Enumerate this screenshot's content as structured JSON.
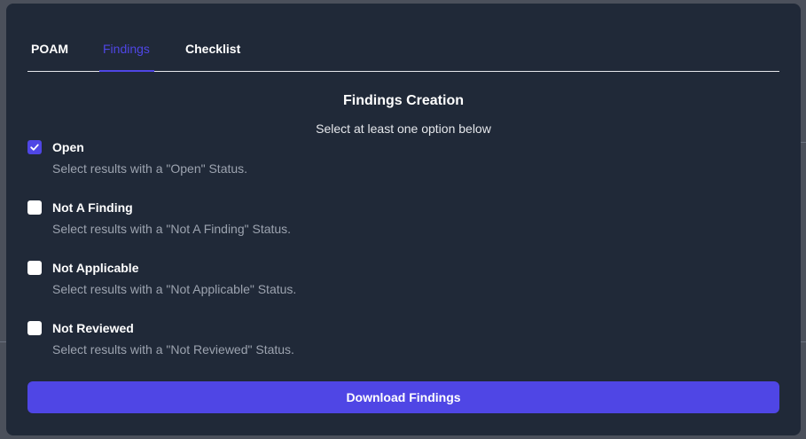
{
  "tabs": [
    {
      "label": "POAM"
    },
    {
      "label": "Findings"
    },
    {
      "label": "Checklist"
    }
  ],
  "active_tab": "Findings",
  "heading": "Findings Creation",
  "subheading": "Select at least one option below",
  "options": [
    {
      "label": "Open",
      "description": "Select results with a \"Open\" Status.",
      "checked": true
    },
    {
      "label": "Not A Finding",
      "description": "Select results with a \"Not A Finding\" Status.",
      "checked": false
    },
    {
      "label": "Not Applicable",
      "description": "Select results with a \"Not Applicable\" Status.",
      "checked": false
    },
    {
      "label": "Not Reviewed",
      "description": "Select results with a \"Not Reviewed\" Status.",
      "checked": false
    }
  ],
  "download_label": "Download Findings",
  "colors": {
    "modal_bg": "#202938",
    "accent": "#4f46e5",
    "text_primary": "#ffffff",
    "text_muted": "#9ca3af"
  },
  "icons": {
    "checkmark": "check-icon"
  }
}
